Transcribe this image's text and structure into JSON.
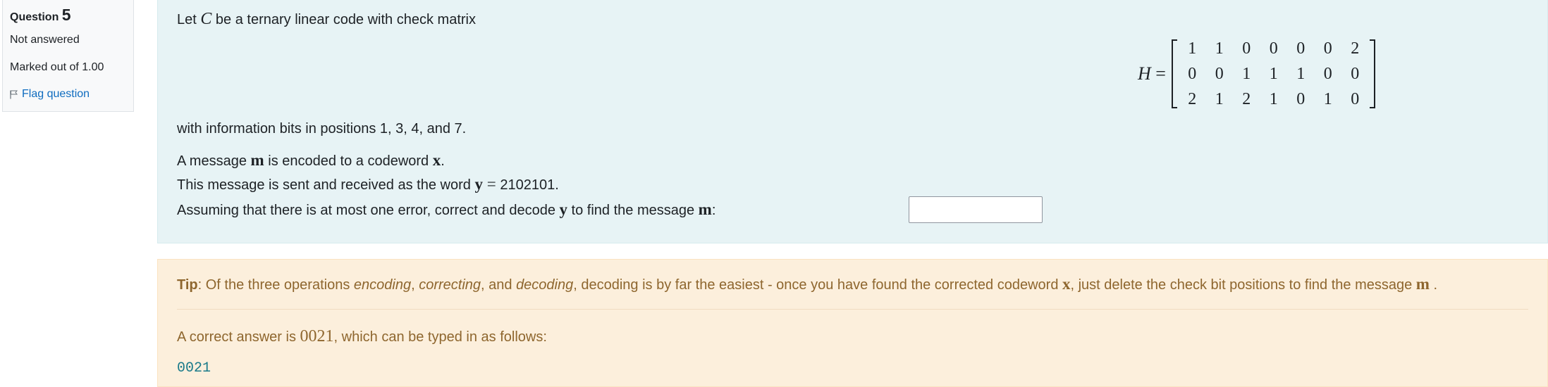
{
  "info": {
    "question_label": "Question",
    "question_number": "5",
    "state": "Not answered",
    "grade": "Marked out of 1.00",
    "flag_label": "Flag question"
  },
  "question": {
    "intro_pre": "Let ",
    "code_symbol": "C",
    "intro_post": " be a ternary linear code with check matrix",
    "matrix_label": "H",
    "matrix_rows": [
      [
        "1",
        "1",
        "0",
        "0",
        "0",
        "0",
        "2"
      ],
      [
        "0",
        "0",
        "1",
        "1",
        "1",
        "0",
        "0"
      ],
      [
        "2",
        "1",
        "2",
        "1",
        "0",
        "1",
        "0"
      ]
    ],
    "info_bits": "with information bits in positions 1, 3, 4, and 7.",
    "msg_line_pre": "A message ",
    "m_symbol": "m",
    "msg_line_mid": " is encoded to a codeword ",
    "x_symbol": "x",
    "msg_line_end": ".",
    "sent_pre": "This message is sent and received as the word ",
    "y_symbol": "y",
    "received_word": "2102101",
    "sent_end": ".",
    "ask_pre": "Assuming that there is at most one error, correct and decode ",
    "ask_mid": " to find the message ",
    "ask_end": ":",
    "answer_value": ""
  },
  "feedback": {
    "tip_label": "Tip",
    "tip_1": ": Of the three operations ",
    "tip_encoding": "encoding",
    "tip_2": ", ",
    "tip_correcting": "correcting",
    "tip_3": ", and ",
    "tip_decoding": "decoding",
    "tip_4": ", decoding is by far the easiest - once you have found the corrected codeword ",
    "tip_5": ", just delete the check bit positions to find the message ",
    "tip_6": " .",
    "answer_pre": "A correct answer is ",
    "answer_value": "0021",
    "answer_post": ", which can be typed in as follows:",
    "typed_answer": "0021"
  },
  "colors": {
    "content_bg": "#e7f3f5",
    "feedback_bg": "#fcefdc",
    "feedback_text": "#8e662e",
    "link": "#0f6cbf"
  }
}
